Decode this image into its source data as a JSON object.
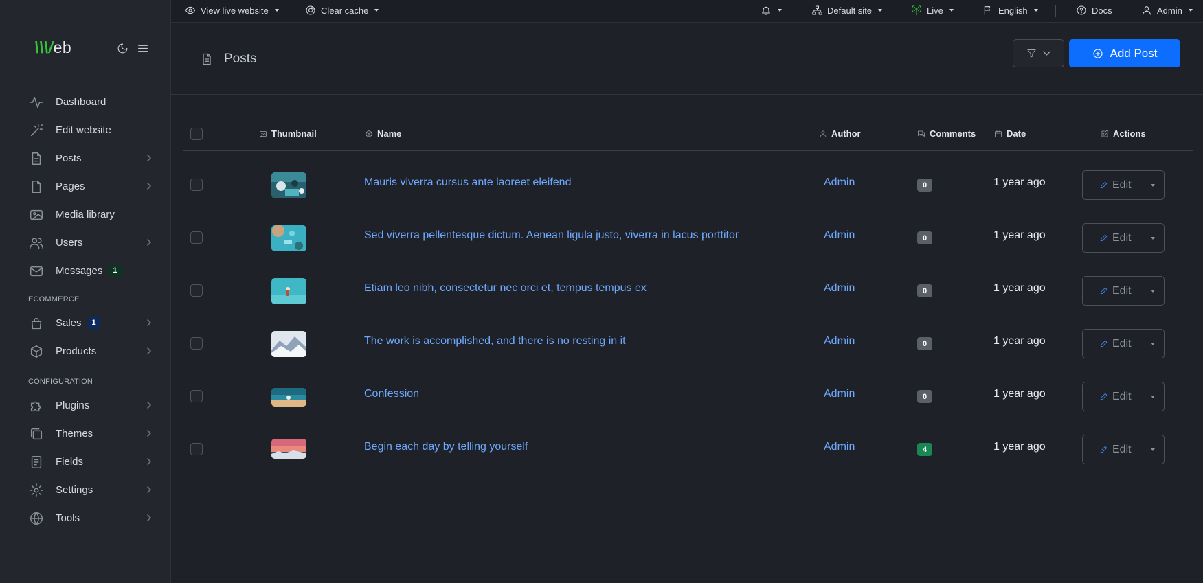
{
  "topbar": {
    "view_live": "View live website",
    "clear_cache": "Clear cache",
    "site": "Default site",
    "live": "Live",
    "language": "English",
    "docs": "Docs",
    "user": "Admin"
  },
  "sidebar": {
    "brand_v": "\\\\\\/",
    "brand_rest": "eb",
    "items": [
      {
        "label": "Dashboard",
        "icon": "activity-icon"
      },
      {
        "label": "Edit website",
        "icon": "magic-wand-icon"
      },
      {
        "label": "Posts",
        "icon": "document-icon"
      },
      {
        "label": "Pages",
        "icon": "page-icon"
      },
      {
        "label": "Media library",
        "icon": "image-icon"
      },
      {
        "label": "Users",
        "icon": "users-icon"
      },
      {
        "label": "Messages",
        "icon": "mail-icon",
        "badge": "1"
      }
    ],
    "section_ecommerce": "ECOMMERCE",
    "ecommerce": [
      {
        "label": "Sales",
        "icon": "bag-icon",
        "badge": "1"
      },
      {
        "label": "Products",
        "icon": "box-icon"
      }
    ],
    "section_config": "CONFIGURATION",
    "config": [
      {
        "label": "Plugins",
        "icon": "puzzle-icon"
      },
      {
        "label": "Themes",
        "icon": "layers-icon"
      },
      {
        "label": "Fields",
        "icon": "form-icon"
      },
      {
        "label": "Settings",
        "icon": "gear-icon"
      },
      {
        "label": "Tools",
        "icon": "globe-icon"
      }
    ]
  },
  "header": {
    "title": "Posts",
    "add_label": "Add Post"
  },
  "table": {
    "columns": {
      "thumbnail": "Thumbnail",
      "name": "Name",
      "author": "Author",
      "comments": "Comments",
      "date": "Date",
      "actions": "Actions"
    },
    "edit_label": "Edit",
    "rows": [
      {
        "name": "Mauris viverra cursus ante laoreet eleifend",
        "author": "Admin",
        "comments": "0",
        "date": "1 year ago"
      },
      {
        "name": "Sed viverra pellentesque dictum. Aenean ligula justo, viverra in lacus porttitor",
        "author": "Admin",
        "comments": "0",
        "date": "1 year ago"
      },
      {
        "name": "Etiam leo nibh, consectetur nec orci et, tempus tempus ex",
        "author": "Admin",
        "comments": "0",
        "date": "1 year ago"
      },
      {
        "name": "The work is accomplished, and there is no resting in it",
        "author": "Admin",
        "comments": "0",
        "date": "1 year ago"
      },
      {
        "name": "Confession",
        "author": "Admin",
        "comments": "0",
        "date": "1 year ago"
      },
      {
        "name": "Begin each day by telling yourself",
        "author": "Admin",
        "comments": "4",
        "date": "1 year ago"
      }
    ]
  },
  "colors": {
    "background": "#1e2127",
    "sidebar": "#23262d",
    "link": "#6ea8fe",
    "primary": "#0d6efd",
    "comment_positive": "#198754"
  }
}
